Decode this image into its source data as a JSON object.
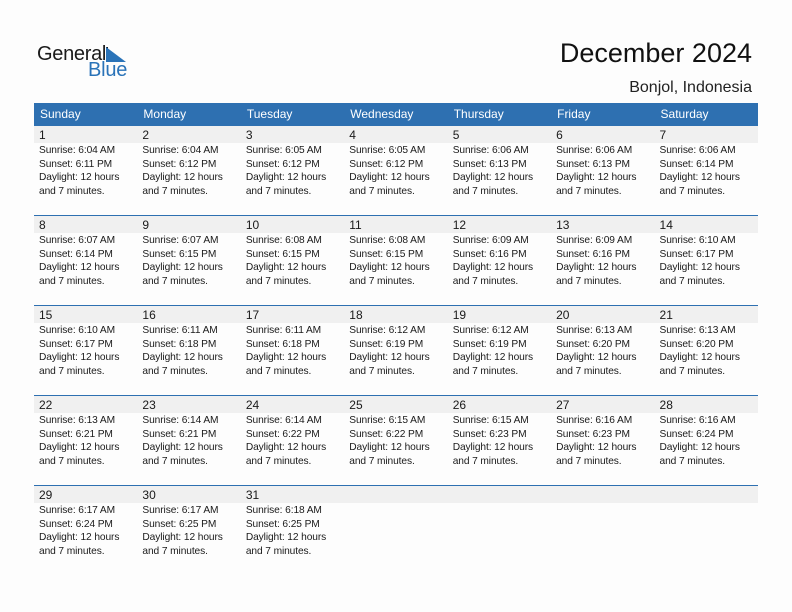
{
  "logo": {
    "word1": "General",
    "word2": "Blue",
    "icon": "triangle-flag-icon"
  },
  "header": {
    "title": "December 2024",
    "location": "Bonjol, Indonesia"
  },
  "colors": {
    "accent": "#2e70b1",
    "day_strip": "#f0f0f0",
    "logo_blue": "#2a73b8"
  },
  "weekdays": [
    "Sunday",
    "Monday",
    "Tuesday",
    "Wednesday",
    "Thursday",
    "Friday",
    "Saturday"
  ],
  "weeks": [
    [
      {
        "day": "1",
        "sunrise": "Sunrise: 6:04 AM",
        "sunset": "Sunset: 6:11 PM",
        "daylight1": "Daylight: 12 hours",
        "daylight2": "and 7 minutes."
      },
      {
        "day": "2",
        "sunrise": "Sunrise: 6:04 AM",
        "sunset": "Sunset: 6:12 PM",
        "daylight1": "Daylight: 12 hours",
        "daylight2": "and 7 minutes."
      },
      {
        "day": "3",
        "sunrise": "Sunrise: 6:05 AM",
        "sunset": "Sunset: 6:12 PM",
        "daylight1": "Daylight: 12 hours",
        "daylight2": "and 7 minutes."
      },
      {
        "day": "4",
        "sunrise": "Sunrise: 6:05 AM",
        "sunset": "Sunset: 6:12 PM",
        "daylight1": "Daylight: 12 hours",
        "daylight2": "and 7 minutes."
      },
      {
        "day": "5",
        "sunrise": "Sunrise: 6:06 AM",
        "sunset": "Sunset: 6:13 PM",
        "daylight1": "Daylight: 12 hours",
        "daylight2": "and 7 minutes."
      },
      {
        "day": "6",
        "sunrise": "Sunrise: 6:06 AM",
        "sunset": "Sunset: 6:13 PM",
        "daylight1": "Daylight: 12 hours",
        "daylight2": "and 7 minutes."
      },
      {
        "day": "7",
        "sunrise": "Sunrise: 6:06 AM",
        "sunset": "Sunset: 6:14 PM",
        "daylight1": "Daylight: 12 hours",
        "daylight2": "and 7 minutes."
      }
    ],
    [
      {
        "day": "8",
        "sunrise": "Sunrise: 6:07 AM",
        "sunset": "Sunset: 6:14 PM",
        "daylight1": "Daylight: 12 hours",
        "daylight2": "and 7 minutes."
      },
      {
        "day": "9",
        "sunrise": "Sunrise: 6:07 AM",
        "sunset": "Sunset: 6:15 PM",
        "daylight1": "Daylight: 12 hours",
        "daylight2": "and 7 minutes."
      },
      {
        "day": "10",
        "sunrise": "Sunrise: 6:08 AM",
        "sunset": "Sunset: 6:15 PM",
        "daylight1": "Daylight: 12 hours",
        "daylight2": "and 7 minutes."
      },
      {
        "day": "11",
        "sunrise": "Sunrise: 6:08 AM",
        "sunset": "Sunset: 6:15 PM",
        "daylight1": "Daylight: 12 hours",
        "daylight2": "and 7 minutes."
      },
      {
        "day": "12",
        "sunrise": "Sunrise: 6:09 AM",
        "sunset": "Sunset: 6:16 PM",
        "daylight1": "Daylight: 12 hours",
        "daylight2": "and 7 minutes."
      },
      {
        "day": "13",
        "sunrise": "Sunrise: 6:09 AM",
        "sunset": "Sunset: 6:16 PM",
        "daylight1": "Daylight: 12 hours",
        "daylight2": "and 7 minutes."
      },
      {
        "day": "14",
        "sunrise": "Sunrise: 6:10 AM",
        "sunset": "Sunset: 6:17 PM",
        "daylight1": "Daylight: 12 hours",
        "daylight2": "and 7 minutes."
      }
    ],
    [
      {
        "day": "15",
        "sunrise": "Sunrise: 6:10 AM",
        "sunset": "Sunset: 6:17 PM",
        "daylight1": "Daylight: 12 hours",
        "daylight2": "and 7 minutes."
      },
      {
        "day": "16",
        "sunrise": "Sunrise: 6:11 AM",
        "sunset": "Sunset: 6:18 PM",
        "daylight1": "Daylight: 12 hours",
        "daylight2": "and 7 minutes."
      },
      {
        "day": "17",
        "sunrise": "Sunrise: 6:11 AM",
        "sunset": "Sunset: 6:18 PM",
        "daylight1": "Daylight: 12 hours",
        "daylight2": "and 7 minutes."
      },
      {
        "day": "18",
        "sunrise": "Sunrise: 6:12 AM",
        "sunset": "Sunset: 6:19 PM",
        "daylight1": "Daylight: 12 hours",
        "daylight2": "and 7 minutes."
      },
      {
        "day": "19",
        "sunrise": "Sunrise: 6:12 AM",
        "sunset": "Sunset: 6:19 PM",
        "daylight1": "Daylight: 12 hours",
        "daylight2": "and 7 minutes."
      },
      {
        "day": "20",
        "sunrise": "Sunrise: 6:13 AM",
        "sunset": "Sunset: 6:20 PM",
        "daylight1": "Daylight: 12 hours",
        "daylight2": "and 7 minutes."
      },
      {
        "day": "21",
        "sunrise": "Sunrise: 6:13 AM",
        "sunset": "Sunset: 6:20 PM",
        "daylight1": "Daylight: 12 hours",
        "daylight2": "and 7 minutes."
      }
    ],
    [
      {
        "day": "22",
        "sunrise": "Sunrise: 6:13 AM",
        "sunset": "Sunset: 6:21 PM",
        "daylight1": "Daylight: 12 hours",
        "daylight2": "and 7 minutes."
      },
      {
        "day": "23",
        "sunrise": "Sunrise: 6:14 AM",
        "sunset": "Sunset: 6:21 PM",
        "daylight1": "Daylight: 12 hours",
        "daylight2": "and 7 minutes."
      },
      {
        "day": "24",
        "sunrise": "Sunrise: 6:14 AM",
        "sunset": "Sunset: 6:22 PM",
        "daylight1": "Daylight: 12 hours",
        "daylight2": "and 7 minutes."
      },
      {
        "day": "25",
        "sunrise": "Sunrise: 6:15 AM",
        "sunset": "Sunset: 6:22 PM",
        "daylight1": "Daylight: 12 hours",
        "daylight2": "and 7 minutes."
      },
      {
        "day": "26",
        "sunrise": "Sunrise: 6:15 AM",
        "sunset": "Sunset: 6:23 PM",
        "daylight1": "Daylight: 12 hours",
        "daylight2": "and 7 minutes."
      },
      {
        "day": "27",
        "sunrise": "Sunrise: 6:16 AM",
        "sunset": "Sunset: 6:23 PM",
        "daylight1": "Daylight: 12 hours",
        "daylight2": "and 7 minutes."
      },
      {
        "day": "28",
        "sunrise": "Sunrise: 6:16 AM",
        "sunset": "Sunset: 6:24 PM",
        "daylight1": "Daylight: 12 hours",
        "daylight2": "and 7 minutes."
      }
    ],
    [
      {
        "day": "29",
        "sunrise": "Sunrise: 6:17 AM",
        "sunset": "Sunset: 6:24 PM",
        "daylight1": "Daylight: 12 hours",
        "daylight2": "and 7 minutes."
      },
      {
        "day": "30",
        "sunrise": "Sunrise: 6:17 AM",
        "sunset": "Sunset: 6:25 PM",
        "daylight1": "Daylight: 12 hours",
        "daylight2": "and 7 minutes."
      },
      {
        "day": "31",
        "sunrise": "Sunrise: 6:18 AM",
        "sunset": "Sunset: 6:25 PM",
        "daylight1": "Daylight: 12 hours",
        "daylight2": "and 7 minutes."
      },
      null,
      null,
      null,
      null
    ]
  ]
}
